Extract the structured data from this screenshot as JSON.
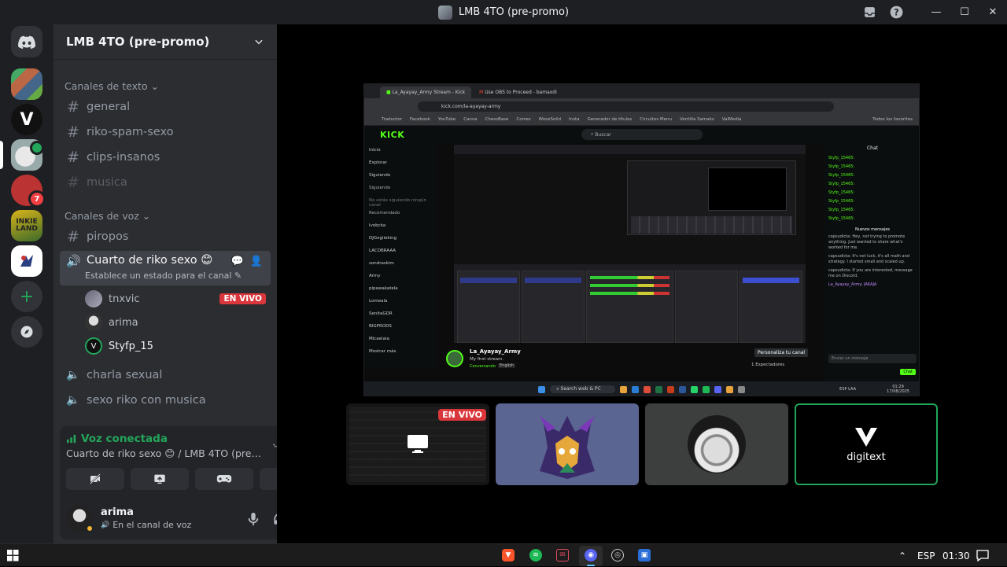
{
  "window": {
    "title": "LMB 4TO (pre-promo)"
  },
  "servers": {
    "mentions_badge": "7"
  },
  "guild": {
    "name": "LMB 4TO (pre-promo)"
  },
  "categories": {
    "text": "Canales de texto",
    "voice": "Canales de voz"
  },
  "text_channels": [
    "general",
    "riko-spam-sexo",
    "clips-insanos",
    "musica"
  ],
  "voice_channels": {
    "piropos": "piropos",
    "active": {
      "name": "Cuarto de riko sexo 😊",
      "status": "Establece un estado para el canal"
    },
    "members": [
      {
        "name": "tnxvic",
        "live": "EN VIVO"
      },
      {
        "name": "arima"
      },
      {
        "name": "Styfp_15"
      }
    ],
    "others": [
      "charla sexual",
      "sexo riko con musica"
    ]
  },
  "voice_panel": {
    "status": "Voz conectada",
    "location": "Cuarto de riko sexo 😊 / LMB 4TO (pre-promo)"
  },
  "user": {
    "name": "arima",
    "status": "En el canal de voz"
  },
  "stream": {
    "browser_tabs": [
      "La_Ayayay_Army Stream - Kick",
      "Use OBS to Proceed - bamaxdi"
    ],
    "url": "kick.com/la-ayayay-army",
    "bookmarks": [
      "Traductor",
      "Facebook",
      "YouTube",
      "Canva",
      "ChessBase",
      "Correo",
      "WooxSolid",
      "Insta",
      "Generador de títulos",
      "Circuitos Menu",
      "Ventilla Samaks",
      "ValMedia",
      "Todos los favoritos"
    ],
    "kick_logo": "KICK",
    "search": "Buscar",
    "sidebar": [
      "Inicio",
      "Explorar",
      "Siguiendo",
      "Siguiendo",
      "No estás siguiendo ningún canal",
      "Recomendado",
      "lvobcka",
      "DJGoglieking",
      "LACOBRAAA",
      "sondraskim",
      "Army",
      "pipawakatela",
      "Lomeala",
      "SenitaGDR",
      "BIGPRODS",
      "Micaelaia",
      "Mostrar más"
    ],
    "chat_title": "Chat",
    "chat_users": [
      "Styfp_15465:",
      "Styfp_15465:",
      "Styfp_15465:",
      "Styfp_15465:",
      "Styfp_15465:",
      "Styfp_15465:",
      "Styfp_15465:",
      "Styfp_15465:"
    ],
    "chat_new": "Nuevos mensajes",
    "chat_messages": [
      "capsudicta: Hey, not trying to promote anything. Just wanted to share what's worked for me.",
      "capsudicta: It's not luck, it's all math and strategy. I started small and scaled up.",
      "capsudicta: If you are interested, message me on Discord.",
      "La_Ayayay_Army: JAKAJA"
    ],
    "chat_input": "Enviar un mensaje",
    "chat_send": "Chat",
    "streamer": "La_Ayayay_Army",
    "stream_title": "My first stream.",
    "stream_category": "Conversando",
    "stream_lang": "English",
    "customize": "Personaliza tu canal",
    "viewers": "1 Espectadores",
    "win_search": "Search web & PC",
    "win_lang": "ESP LAA",
    "win_time": "01:29",
    "win_date": "17/08/2025"
  },
  "tiles": [
    {
      "label": "EN VIVO"
    },
    {
      "label": ""
    },
    {
      "label": ""
    },
    {
      "label": "digitext"
    }
  ],
  "taskbar": {
    "lang": "ESP",
    "time": "01:30"
  },
  "colors": {
    "accent": "#5865f2",
    "green": "#23a55a",
    "live": "#da373c",
    "kick": "#53fc18"
  }
}
